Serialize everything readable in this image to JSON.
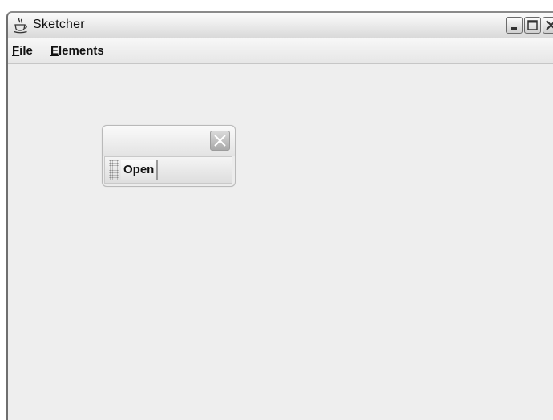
{
  "window": {
    "title": "Sketcher",
    "app_icon": "java-cup-icon",
    "controls": [
      "minimize-icon",
      "maximize-icon",
      "close-icon"
    ]
  },
  "menubar": {
    "items": [
      {
        "label_mnemonic": "F",
        "label_rest": "ile"
      },
      {
        "label_mnemonic": "E",
        "label_rest": "lements"
      }
    ]
  },
  "floating_toolbar": {
    "title": "",
    "close_icon": "close-icon",
    "grip_icon": "drag-grip-icon",
    "buttons": [
      {
        "label": "Open"
      }
    ]
  }
}
